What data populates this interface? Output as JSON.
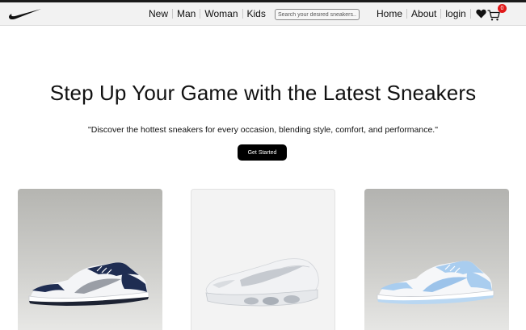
{
  "nav": {
    "left_links": [
      "New",
      "Man",
      "Woman",
      "Kids"
    ],
    "search_placeholder": "Search your desired sneakers...",
    "right_links": [
      "Home",
      "About",
      "login"
    ],
    "cart_count": "0",
    "icons": [
      "nike-swoosh-logo",
      "heart-icon",
      "cart-icon"
    ]
  },
  "hero": {
    "title": "Step Up Your Game with the Latest Sneakers",
    "subtitle": "\"Discover the hottest sneakers for every occasion, blending style, comfort, and performance.\"",
    "cta_label": "Get Started"
  },
  "products": [
    {
      "image": "navy-white-low-sneaker",
      "accent": "#1f2d52"
    },
    {
      "image": "white-silver-air-sneaker",
      "accent": "#e9ecef"
    },
    {
      "image": "light-blue-white-low-sneaker",
      "accent": "#a9cdef"
    }
  ],
  "colors": {
    "cta": "#000000",
    "badge": "#e11919",
    "navbar": "#f2f2f2"
  }
}
